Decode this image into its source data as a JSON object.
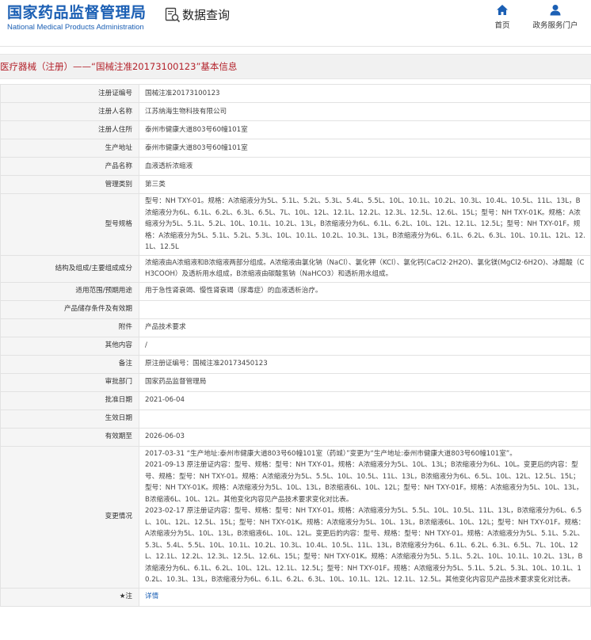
{
  "header": {
    "brand_cn": "国家药品监督管理局",
    "brand_en": "National Medical Products Administration",
    "data_query": "数据查询",
    "nav": {
      "home": "首页",
      "gov": "政务服务门户"
    }
  },
  "page_title": "医疗器械（注册）——“国械注准20173100123”基本信息",
  "fields": [
    {
      "label": "注册证编号",
      "value": "国械注准20173100123"
    },
    {
      "label": "注册人名称",
      "value": "江苏纳海生物科技有限公司"
    },
    {
      "label": "注册人住所",
      "value": "泰州市健康大道803号60幢101室"
    },
    {
      "label": "生产地址",
      "value": "泰州市健康大道803号60幢101室"
    },
    {
      "label": "产品名称",
      "value": "血液透析浓缩液"
    },
    {
      "label": "管理类别",
      "value": "第三类"
    },
    {
      "label": "型号规格",
      "value": "型号：NH TXY-01。规格：A浓缩液分为5L、5.1L、5.2L、5.3L、5.4L、5.5L、10L、10.1L、10.2L、10.3L、10.4L、10.5L、11L、13L，B浓缩液分为6L、6.1L、6.2L、6.3L、6.5L、7L、10L、12L、12.1L、12.2L、12.3L、12.5L、12.6L、15L；型号：NH TXY-01K。规格：A浓缩液分为5L、5.1L、5.2L、10L、10.1L、10.2L、13L，B浓缩液分为6L、6.1L、6.2L、10L、12L、12.1L、12.5L；型号：NH TXY-01F。规格：A浓缩液分为5L、5.1L、5.2L、5.3L、10L、10.1L、10.2L、10.3L、13L，B浓缩液分为6L、6.1L、6.2L、6.3L、10L、10.1L、12L、12.1L、12.5L"
    },
    {
      "label": "结构及组成/主要组成成分",
      "value": "浓缩液由A浓缩液和B浓缩液两部分组成。A浓缩液由氯化钠（NaCl）、氯化钾（KCl）、氯化钙(CaCl2·2H2O)、氯化镁(MgCl2·6H2O)、冰醋酸（CH3COOH）及透析用水组成，B浓缩液由碳酸氢钠（NaHCO3）和透析用水组成。"
    },
    {
      "label": "适用范围/预期用途",
      "value": "用于急性肾衰竭、慢性肾衰竭（尿毒症）的血液透析治疗。"
    },
    {
      "label": "产品储存条件及有效期",
      "value": ""
    },
    {
      "label": "附件",
      "value": "产品技术要求"
    },
    {
      "label": "其他内容",
      "value": "/"
    },
    {
      "label": "备注",
      "value": "原注册证编号：国械注准20173450123"
    },
    {
      "label": "审批部门",
      "value": "国家药品监督管理局"
    },
    {
      "label": "批准日期",
      "value": "2021-06-04"
    },
    {
      "label": "生效日期",
      "value": ""
    },
    {
      "label": "有效期至",
      "value": "2026-06-03"
    }
  ],
  "changes": {
    "label": "变更情况",
    "entries": [
      "2017-03-31 “生产地址:泰州市健康大道803号60幢101室（药城）”变更为“生产地址:泰州市健康大道803号60幢101室”。",
      "2021-09-13 原注册证内容：型号、规格：型号：NH TXY-01。规格：A浓缩液分为5L、10L、13L；B浓缩液分为6L、10L。变更后的内容：型号、规格：型号：NH TXY-01。规格：A浓缩液分为5L、5.5L、10L、10.5L、11L、13L，B浓缩液分为6L、6.5L、10L、12L、12.5L、15L；型号：NH TXY-01K。规格：A浓缩液分为5L、10L、13L，B浓缩液6L、10L、12L；型号：NH TXY-01F。规格：A浓缩液分为5L、10L、13L，B浓缩液6L、10L、12L。其他变化内容见产品技术要求变化对比表。",
      "2023-02-17 原注册证内容：型号、规格：型号：NH TXY-01。规格：A浓缩液分为5L、5.5L、10L、10.5L、11L、13L，B浓缩液分为6L、6.5L、10L、12L、12.5L、15L；型号：NH TXY-01K。规格：A浓缩液分为5L、10L、13L，B浓缩液6L、10L、12L；型号：NH TXY-01F。规格：A浓缩液分为5L、10L、13L，B浓缩液6L、10L、12L。变更后的内容：型号、规格：型号：NH TXY-01。规格：A浓缩液分为5L、5.1L、5.2L、5.3L、5.4L、5.5L、10L、10.1L、10.2L、10.3L、10.4L、10.5L、11L、13L，B浓缩液分为6L、6.1L、6.2L、6.3L、6.5L、7L、10L、12L、12.1L、12.2L、12.3L、12.5L、12.6L、15L；型号：NH TXY-01K。规格：A浓缩液分为5L、5.1L、5.2L、10L、10.1L、10.2L、13L，B浓缩液分为6L、6.1L、6.2L、10L、12L、12.1L、12.5L；型号：NH TXY-01F。规格：A浓缩液分为5L、5.1L、5.2L、5.3L、10L、10.1L、10.2L、10.3L、13L，B浓缩液分为6L、6.1L、6.2L、6.3L、10L、10.1L、12L、12.1L、12.5L。其他变化内容见产品技术要求变化对比表。"
    ]
  },
  "note": {
    "label": "★注",
    "link": "详情"
  }
}
